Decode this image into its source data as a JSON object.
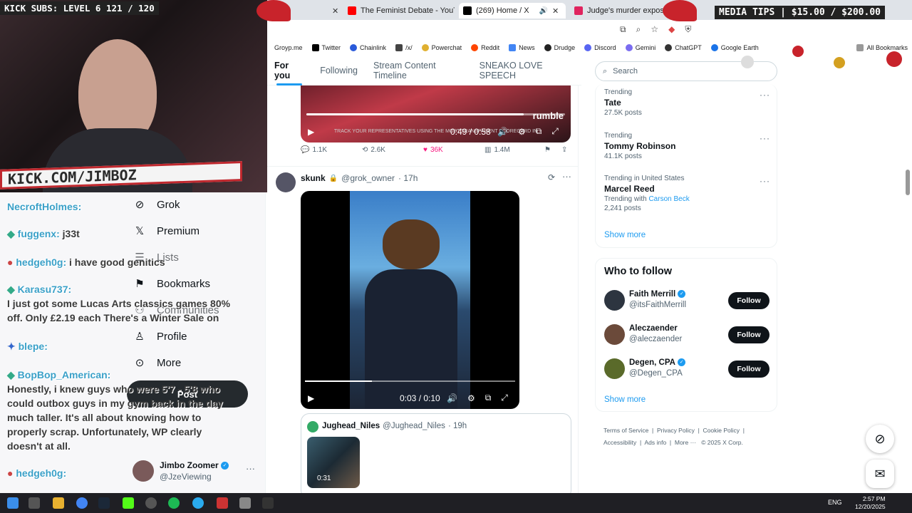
{
  "overlay": {
    "kick_subs": "KICK SUBS: LEVEL 6 121 / 120",
    "media_tips": "MEDIA TIPS | $15.00 / $200.00",
    "kick_url": "KICK.COM/JIMBOZ"
  },
  "browser": {
    "tabs": [
      {
        "label": "The Feminist Debate - YouTube",
        "color": "#ff0000"
      },
      {
        "label": "(269) Home / X",
        "color": "#000000"
      },
      {
        "label": "Judge's murder exposes secret",
        "color": "#e0245e"
      }
    ],
    "bookmarks": [
      "Groyp.me",
      "Twitter",
      "Chainlink",
      "/x/",
      "Powerchat",
      "Reddit",
      "News",
      "Drudge",
      "Discord",
      "Gemini",
      "ChatGPT",
      "Google Earth"
    ],
    "bookmarks_all": "All Bookmarks"
  },
  "x_nav": {
    "tabs": [
      "For you",
      "Following",
      "Stream Content Timeline",
      "SNEAKO LOVE SPEECH"
    ],
    "active": "For you"
  },
  "feed": {
    "post1": {
      "video_time": "0:49 / 0:58",
      "banner_text": "TRACK YOUR REPRESENTATIVES USING THE MOST TRANSPARENT SCORECARD IN",
      "watermark": "rumble",
      "replies": "1.1K",
      "reposts": "2.6K",
      "likes": "36K",
      "views": "1.4M"
    },
    "post2": {
      "name": "skunk",
      "handle": "@grok_owner",
      "time": "· 17h",
      "video_time": "0:03 / 0:10",
      "quoted_name": "Jughead_Niles",
      "quoted_handle": "@Jughead_Niles",
      "quoted_time": "· 19h",
      "quoted_duration": "0:31"
    }
  },
  "sidebar_right": {
    "search_placeholder": "Search",
    "trends": [
      {
        "label": "Trending",
        "name": "Tate",
        "count": "27.5K posts"
      },
      {
        "label": "Trending",
        "name": "Tommy Robinson",
        "count": "41.1K posts"
      },
      {
        "label": "Trending in United States",
        "name": "Marcel Reed",
        "with_label": "Trending with",
        "with_name": "Carson Beck",
        "count": "2,241 posts"
      }
    ],
    "show_more": "Show more",
    "who_to_follow_title": "Who to follow",
    "follow_suggestions": [
      {
        "name": "Faith Merrill",
        "handle": "@itsFaithMerrill",
        "verified": true
      },
      {
        "name": "Aleczaender",
        "handle": "@aleczaender",
        "verified": false
      },
      {
        "name": "Degen, CPA",
        "handle": "@Degen_CPA",
        "verified": true
      }
    ],
    "follow_label": "Follow",
    "show_more_2": "Show more",
    "footer": [
      "Terms of Service",
      "Privacy Policy",
      "Cookie Policy",
      "Accessibility",
      "Ads info",
      "More ···",
      "© 2025 X Corp."
    ]
  },
  "x_menu": {
    "items": [
      "Grok",
      "Premium",
      "Lists",
      "Bookmarks",
      "Communities",
      "Profile",
      "More"
    ],
    "post_button": "Post",
    "account_name": "Jimbo Zoomer",
    "account_handle": "@JzeViewing"
  },
  "chat": [
    {
      "user": "NecroftHolmes:",
      "msg": ""
    },
    {
      "user": "fuggenx:",
      "msg": "j33t"
    },
    {
      "user": "hedgeh0g:",
      "msg": "i have good genitics"
    },
    {
      "user": "Karasu737:",
      "msg": "I just got some Lucas Arts classics games 80% off. Only £2.19 each There's a Winter Sale on"
    },
    {
      "user": "blepe:",
      "msg": ""
    },
    {
      "user": "BopBop_American:",
      "msg": "Honestly, i knew guys who were 5'7 - 5'8 who could outbox guys in my gym back in the day much taller. It's all about knowing how to properly scrap. Unfortunately, WP clearly doesn't at all."
    },
    {
      "user": "hedgeh0g:",
      "msg": ""
    }
  ],
  "taskbar": {
    "lang": "ENG",
    "time": "2:57 PM",
    "date": "12/20/2025"
  }
}
